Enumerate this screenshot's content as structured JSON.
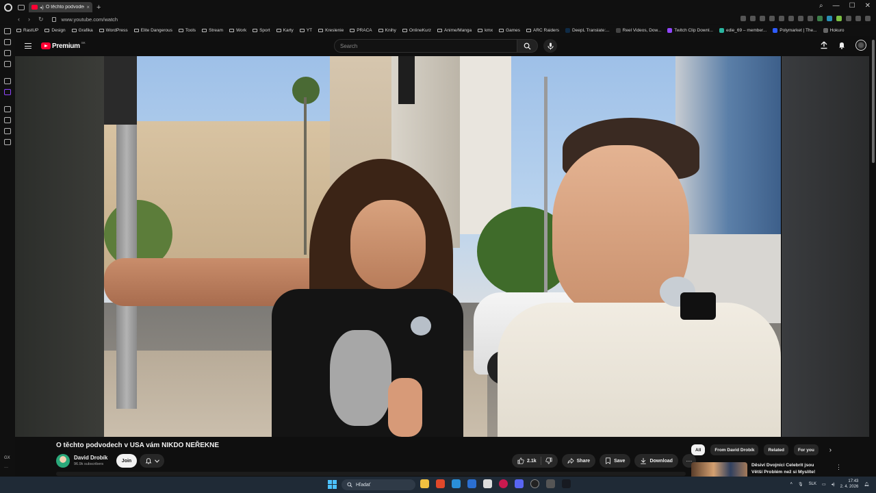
{
  "browser": {
    "tab_title": "O těchto podvodech v",
    "url": "www.youtube.com/watch",
    "bookmarks": [
      "RastUP",
      "Design",
      "Grafika",
      "WordPress",
      "Elite Dangerous",
      "Tools",
      "Stream",
      "Work",
      "Sport",
      "Karty",
      "YT",
      "Kreslenie",
      "PRACA",
      "Knihy",
      "OnlineKurz",
      "Anime/Manga",
      "kmx",
      "Games",
      "ARC Raiders",
      "DeepL Translate:...",
      "Reel Videos, Dow...",
      "Twitch Clip Downl...",
      "edie_69 – member...",
      "Polymarket | The...",
      "Hokuro"
    ],
    "sidebar_label": "GX"
  },
  "youtube": {
    "brand": "Premium",
    "country_code": "SK",
    "search_placeholder": "Search",
    "video_title": "O těchto podvodech v USA vám NIKDO NEŘEKNE",
    "channel_name": "David Drobík",
    "subscribers": "96.9k subscribers",
    "join_label": "Join",
    "like_count": "2.1k",
    "share_label": "Share",
    "save_label": "Save",
    "download_label": "Download",
    "more_label": "···",
    "chips": [
      "All",
      "From David Drobík",
      "Related",
      "For you"
    ],
    "recommendation": {
      "title_line1": "Děsiví Dvojníci Celebrit jsou",
      "title_line2": "Větší Problém než si Myslíte!"
    }
  },
  "taskbar": {
    "search_placeholder": "Hľadať",
    "language": "SLK",
    "time": "17:43",
    "date": "2. 4. 2026"
  },
  "colors": {
    "youtube_red": "#ff0033",
    "page_bg": "#0f0f0f",
    "taskbar_bg": "#1f2a36"
  }
}
